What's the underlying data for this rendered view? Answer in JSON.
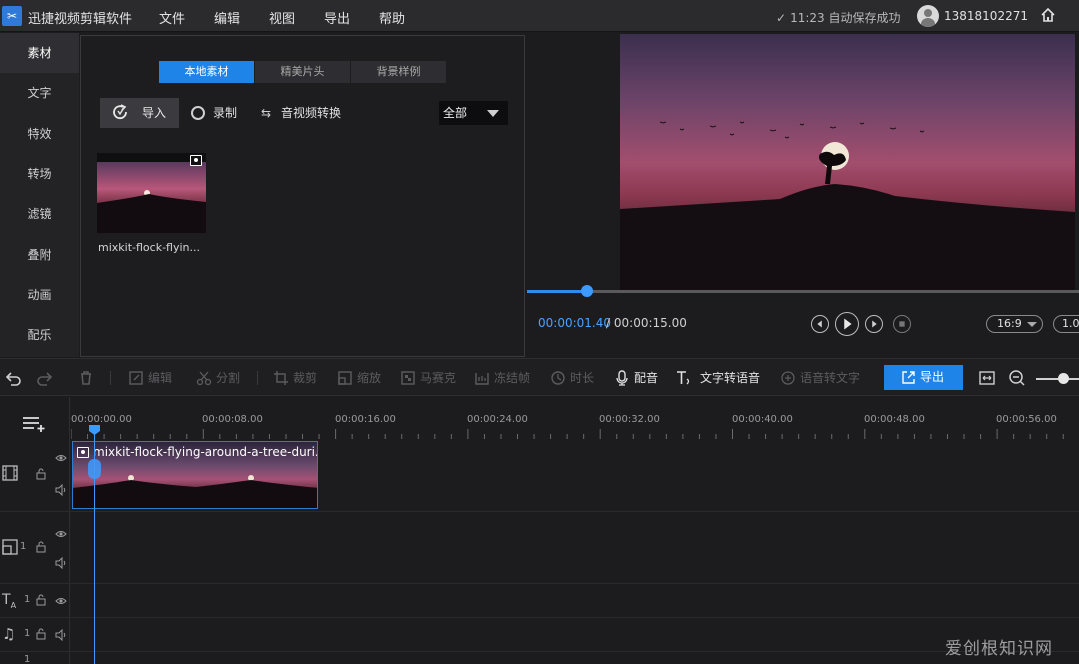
{
  "app": {
    "title": "迅捷视频剪辑软件",
    "menu": [
      "文件",
      "编辑",
      "视图",
      "导出",
      "帮助"
    ],
    "save_status": "11:23 自动保存成功",
    "user_phone": "13818102271"
  },
  "sidebar": {
    "items": [
      {
        "label": "素材",
        "active": true
      },
      {
        "label": "文字"
      },
      {
        "label": "特效"
      },
      {
        "label": "转场"
      },
      {
        "label": "滤镜"
      },
      {
        "label": "叠附"
      },
      {
        "label": "动画"
      },
      {
        "label": "配乐"
      }
    ]
  },
  "media": {
    "tabs": [
      {
        "label": "本地素材",
        "active": true
      },
      {
        "label": "精美片头"
      },
      {
        "label": "背景样例"
      }
    ],
    "import_label": "导入",
    "record_label": "录制",
    "convert_label": "音视频转换",
    "filter_value": "全部",
    "clips": [
      {
        "name": "mixkit-flock-flyin..."
      }
    ]
  },
  "preview": {
    "current_time": "00:00:01.40",
    "separator": "/",
    "total_time": "00:00:15.00",
    "progress": 0.108,
    "aspect_ratio": "16:9",
    "zoom": "1.0"
  },
  "toolbar": {
    "items": [
      "编辑",
      "分割",
      "裁剪",
      "缩放",
      "马赛克",
      "冻结帧",
      "时长",
      "配音",
      "文字转语音",
      "语音转文字"
    ],
    "export_label": "导出"
  },
  "timeline": {
    "ruler_labels": [
      "00:00:00.00",
      "00:00:08.00",
      "00:00:16.00",
      "00:00:24.00",
      "00:00:32.00",
      "00:00:40.00",
      "00:00:48.00",
      "00:00:56.00"
    ],
    "clip_name": "mixkit-flock-flying-around-a-tree-duri...",
    "track_numbers": [
      "1",
      "1",
      "1",
      "1"
    ]
  },
  "colors": {
    "accent": "#1e84e8",
    "background": "#1c1c1e",
    "playhead": "#3d9bff"
  },
  "watermark": "爱创根知识网"
}
